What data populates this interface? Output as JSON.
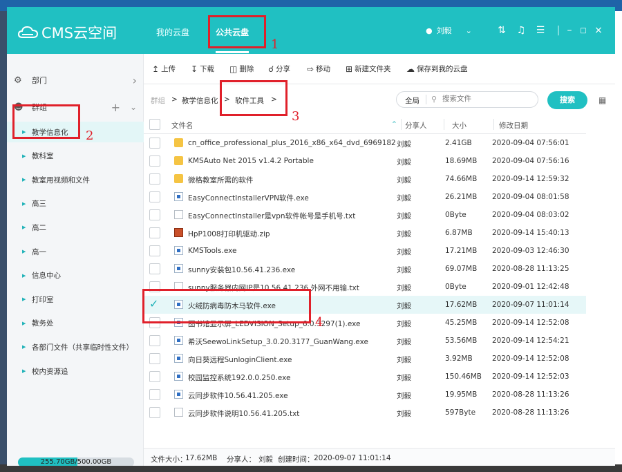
{
  "app": {
    "logo_text": "CMS云空间",
    "tabs": [
      {
        "label": "我的云盘",
        "active": false
      },
      {
        "label": "公共云盘",
        "active": true
      }
    ],
    "user_name": "刘毅",
    "accent_color": "#20c0c2"
  },
  "sidebar": {
    "sections": [
      {
        "label": "部门",
        "right_icon": "chevron-right-icon"
      },
      {
        "label": "群组",
        "right_icons": [
          "plus-icon",
          "chevron-down-icon"
        ]
      }
    ],
    "items": [
      {
        "label": "教学信息化",
        "active": true
      },
      {
        "label": "教科室"
      },
      {
        "label": "教室用视频和文件"
      },
      {
        "label": "高三"
      },
      {
        "label": "高二"
      },
      {
        "label": "高一"
      },
      {
        "label": "信息中心"
      },
      {
        "label": "打印室"
      },
      {
        "label": "教务处"
      },
      {
        "label": "各部门文件（共享临时性文件）"
      },
      {
        "label": "校内资源追"
      }
    ],
    "storage": {
      "text": "255.70GB/500.00GB",
      "used_fraction": 0.511
    }
  },
  "toolbar": {
    "buttons": [
      {
        "label": "上传",
        "icon": "upload-icon"
      },
      {
        "label": "下载",
        "icon": "download-icon"
      },
      {
        "label": "删除",
        "icon": "trash-icon"
      },
      {
        "label": "分享",
        "icon": "share-icon"
      },
      {
        "label": "移动",
        "icon": "move-icon"
      },
      {
        "label": "新建文件夹",
        "icon": "new-folder-icon"
      },
      {
        "label": "保存到我的云盘",
        "icon": "save-to-cloud-icon"
      }
    ]
  },
  "breadcrumb": {
    "items": [
      "群组",
      "教学信息化",
      "软件工具"
    ],
    "separator": ">"
  },
  "search": {
    "scope": "全局",
    "placeholder": "搜索文件",
    "button_label": "搜索"
  },
  "table": {
    "columns": {
      "name": "文件名",
      "owner": "分享人",
      "size": "大小",
      "date": "修改日期"
    },
    "rows": [
      {
        "type": "folder",
        "name": "cn_office_professional_plus_2016_x86_x64_dvd_6969182",
        "owner": "刘毅",
        "size": "2.41GB",
        "date": "2020-09-04 07:56:01"
      },
      {
        "type": "folder",
        "name": "KMSAuto Net 2015 v1.4.2 Portable",
        "owner": "刘毅",
        "size": "18.69MB",
        "date": "2020-09-04 07:56:16"
      },
      {
        "type": "folder",
        "name": "微格教室所需的软件",
        "owner": "刘毅",
        "size": "74.66MB",
        "date": "2020-09-14 12:59:32"
      },
      {
        "type": "exe",
        "name": "EasyConnectInstallerVPN软件.exe",
        "owner": "刘毅",
        "size": "26.21MB",
        "date": "2020-09-04 08:01:58"
      },
      {
        "type": "txt",
        "name": "EasyConnectInstaller是vpn软件帐号是手机号.txt",
        "owner": "刘毅",
        "size": "0Byte",
        "date": "2020-09-04 08:03:02"
      },
      {
        "type": "zip",
        "name": "HpP1008打印机驱动.zip",
        "owner": "刘毅",
        "size": "6.87MB",
        "date": "2020-09-14 15:40:13"
      },
      {
        "type": "exe",
        "name": "KMSTools.exe",
        "owner": "刘毅",
        "size": "17.21MB",
        "date": "2020-09-03 12:46:30"
      },
      {
        "type": "exe",
        "name": "sunny安装包10.56.41.236.exe",
        "owner": "刘毅",
        "size": "69.07MB",
        "date": "2020-08-28 11:13:25"
      },
      {
        "type": "txt",
        "name": "sunny服务器内网IP是10.56.41.236 外网不用输.txt",
        "owner": "刘毅",
        "size": "0Byte",
        "date": "2020-09-01 12:42:48"
      },
      {
        "type": "exe",
        "name": "火绒防病毒防木马软件.exe",
        "owner": "刘毅",
        "size": "17.62MB",
        "date": "2020-09-07 11:01:14",
        "selected": true
      },
      {
        "type": "exe",
        "name": "图书馆显示屏_LEDVISION_Setup_6.0.3297(1).exe",
        "owner": "刘毅",
        "size": "45.25MB",
        "date": "2020-09-14 12:52:08"
      },
      {
        "type": "exe",
        "name": "希沃SeewoLinkSetup_3.0.20.3177_GuanWang.exe",
        "owner": "刘毅",
        "size": "53.56MB",
        "date": "2020-09-14 12:54:21"
      },
      {
        "type": "exe",
        "name": "向日葵远程SunloginClient.exe",
        "owner": "刘毅",
        "size": "3.92MB",
        "date": "2020-09-14 12:52:08"
      },
      {
        "type": "exe",
        "name": "校园监控系统192.0.0.250.exe",
        "owner": "刘毅",
        "size": "150.46MB",
        "date": "2020-09-14 12:52:03"
      },
      {
        "type": "exe",
        "name": "云同步软件10.56.41.205.exe",
        "owner": "刘毅",
        "size": "19.95MB",
        "date": "2020-08-28 11:13:26"
      },
      {
        "type": "txt",
        "name": "云同步软件说明10.56.41.205.txt",
        "owner": "刘毅",
        "size": "597Byte",
        "date": "2020-08-28 11:13:26"
      }
    ]
  },
  "status": {
    "size_label": "文件大小：",
    "size_value": "17.62MB",
    "owner_label": "分享人：",
    "owner_value": "刘毅",
    "created_label": "创建时间：",
    "created_value": "2020-09-07 11:01:14"
  },
  "annotations": [
    "1",
    "2",
    "3",
    "4"
  ]
}
